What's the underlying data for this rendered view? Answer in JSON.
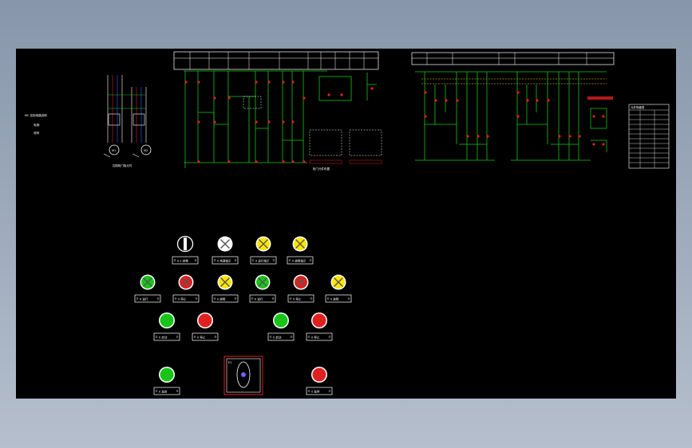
{
  "drawing": {
    "motor_labels": [
      "M1",
      "M2"
    ],
    "left_notes": [
      "MC 控制电路说明",
      "电源:",
      "说明"
    ],
    "center_controls_label": "控制柜门板元件",
    "panel_caption": "柜门元件布置",
    "table_title": "元件明细表"
  },
  "indicator_rows": [
    [
      {
        "kind": "selector",
        "label": "0-1 转换"
      },
      {
        "kind": "lamp",
        "color": "#ffffff",
        "label": "0 电源指示"
      },
      {
        "kind": "lamp",
        "color": "#ffe500",
        "label": "0 运行指示"
      },
      {
        "kind": "lamp",
        "color": "#ffe500",
        "label": "0 故障指示"
      }
    ],
    [
      {
        "kind": "lamp",
        "color": "#18c418",
        "label": "0 运行"
      },
      {
        "kind": "lamp",
        "color": "#e02020",
        "label": "0 停止"
      },
      {
        "kind": "lamp",
        "color": "#ffe500",
        "label": "0 故障"
      },
      {
        "kind": "lamp",
        "color": "#18c418",
        "label": "0 运行"
      },
      {
        "kind": "lamp",
        "color": "#e02020",
        "label": "0 停止"
      },
      {
        "kind": "lamp",
        "color": "#ffe500",
        "label": "0 故障"
      }
    ]
  ],
  "buttons": [
    {
      "color": "#18c418",
      "label": "0 启动"
    },
    {
      "color": "#e02020",
      "label": "0 停止"
    },
    {
      "color": "#18c418",
      "label": "0 启动"
    },
    {
      "color": "#e02020",
      "label": "0 停止"
    }
  ],
  "bottom_buttons": [
    {
      "color": "#18c418",
      "label": "0 急启"
    },
    {
      "color": "#e02020",
      "label": "0 急停"
    }
  ],
  "emergency_box_label": "E1"
}
